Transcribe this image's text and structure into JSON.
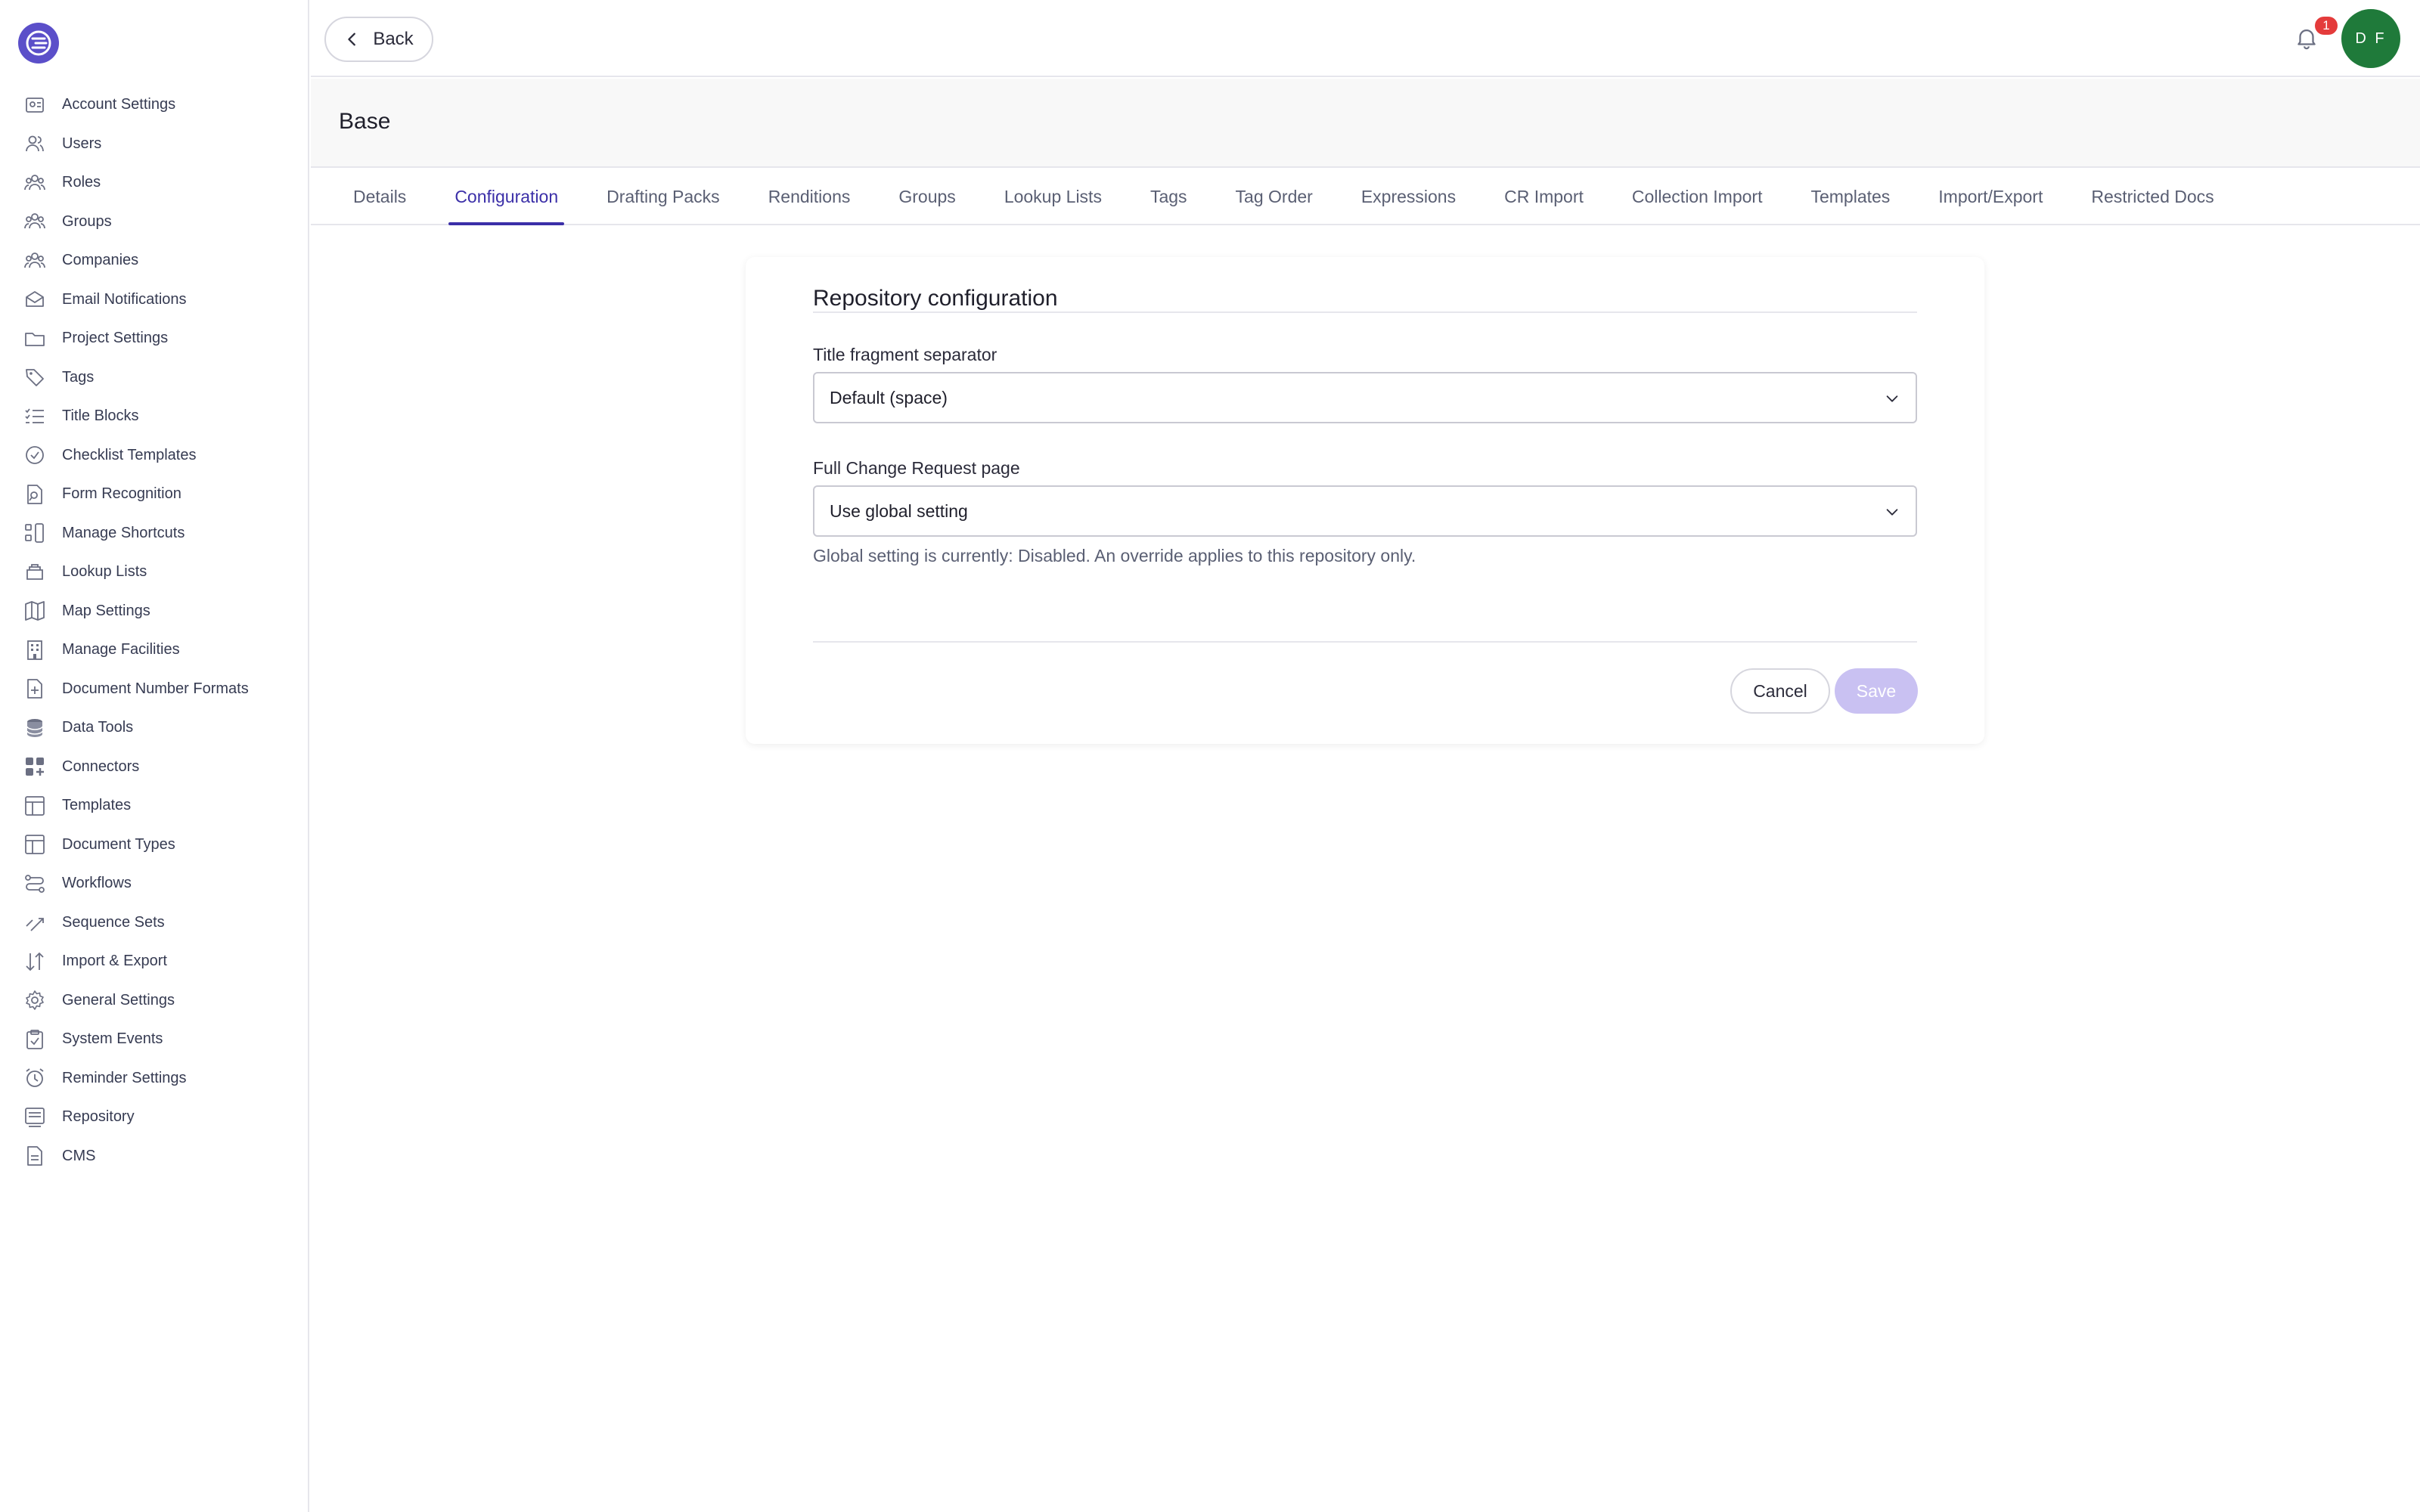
{
  "sidebar": {
    "items": [
      {
        "label": "Account Settings",
        "icon": "account-settings-icon"
      },
      {
        "label": "Users",
        "icon": "users-icon"
      },
      {
        "label": "Roles",
        "icon": "roles-icon"
      },
      {
        "label": "Groups",
        "icon": "groups-icon"
      },
      {
        "label": "Companies",
        "icon": "companies-icon"
      },
      {
        "label": "Email Notifications",
        "icon": "envelope-icon"
      },
      {
        "label": "Project Settings",
        "icon": "folder-icon"
      },
      {
        "label": "Tags",
        "icon": "tag-icon"
      },
      {
        "label": "Title Blocks",
        "icon": "list-check-icon"
      },
      {
        "label": "Checklist Templates",
        "icon": "check-circle-icon"
      },
      {
        "label": "Form Recognition",
        "icon": "document-search-icon"
      },
      {
        "label": "Manage Shortcuts",
        "icon": "shortcuts-icon"
      },
      {
        "label": "Lookup Lists",
        "icon": "stack-icon"
      },
      {
        "label": "Map Settings",
        "icon": "map-icon"
      },
      {
        "label": "Manage Facilities",
        "icon": "building-icon"
      },
      {
        "label": "Document Number Formats",
        "icon": "document-plus-icon"
      },
      {
        "label": "Data Tools",
        "icon": "database-icon"
      },
      {
        "label": "Connectors",
        "icon": "connectors-icon"
      },
      {
        "label": "Templates",
        "icon": "layout-icon"
      },
      {
        "label": "Document Types",
        "icon": "document-types-icon"
      },
      {
        "label": "Workflows",
        "icon": "workflow-icon"
      },
      {
        "label": "Sequence Sets",
        "icon": "sequence-icon"
      },
      {
        "label": "Import & Export",
        "icon": "arrows-up-down-icon"
      },
      {
        "label": "General Settings",
        "icon": "gear-icon"
      },
      {
        "label": "System Events",
        "icon": "clipboard-check-icon"
      },
      {
        "label": "Reminder Settings",
        "icon": "alarm-clock-icon"
      },
      {
        "label": "Repository",
        "icon": "repository-icon"
      },
      {
        "label": "CMS",
        "icon": "file-icon"
      }
    ]
  },
  "header": {
    "back_label": "Back",
    "notification_count": "1",
    "avatar_initials": "D F"
  },
  "page": {
    "title": "Base"
  },
  "tabs": [
    {
      "label": "Details",
      "active": false
    },
    {
      "label": "Configuration",
      "active": true
    },
    {
      "label": "Drafting Packs",
      "active": false
    },
    {
      "label": "Renditions",
      "active": false
    },
    {
      "label": "Groups",
      "active": false
    },
    {
      "label": "Lookup Lists",
      "active": false
    },
    {
      "label": "Tags",
      "active": false
    },
    {
      "label": "Tag Order",
      "active": false
    },
    {
      "label": "Expressions",
      "active": false
    },
    {
      "label": "CR Import",
      "active": false
    },
    {
      "label": "Collection Import",
      "active": false
    },
    {
      "label": "Templates",
      "active": false
    },
    {
      "label": "Import/Export",
      "active": false
    },
    {
      "label": "Restricted Docs",
      "active": false
    }
  ],
  "card": {
    "title": "Repository configuration",
    "separator": {
      "label": "Title fragment separator",
      "value": "Default (space)"
    },
    "cr_page": {
      "label": "Full Change Request page",
      "value": "Use global setting",
      "help": "Global setting is currently: Disabled. An override applies to this repository only."
    },
    "cancel_label": "Cancel",
    "save_label": "Save"
  },
  "colors": {
    "accent": "#3b2fa8",
    "logo": "#5b4fc9",
    "avatar": "#1f7a3a",
    "badge": "#e43b3b",
    "save_disabled": "#c9c1f2"
  }
}
